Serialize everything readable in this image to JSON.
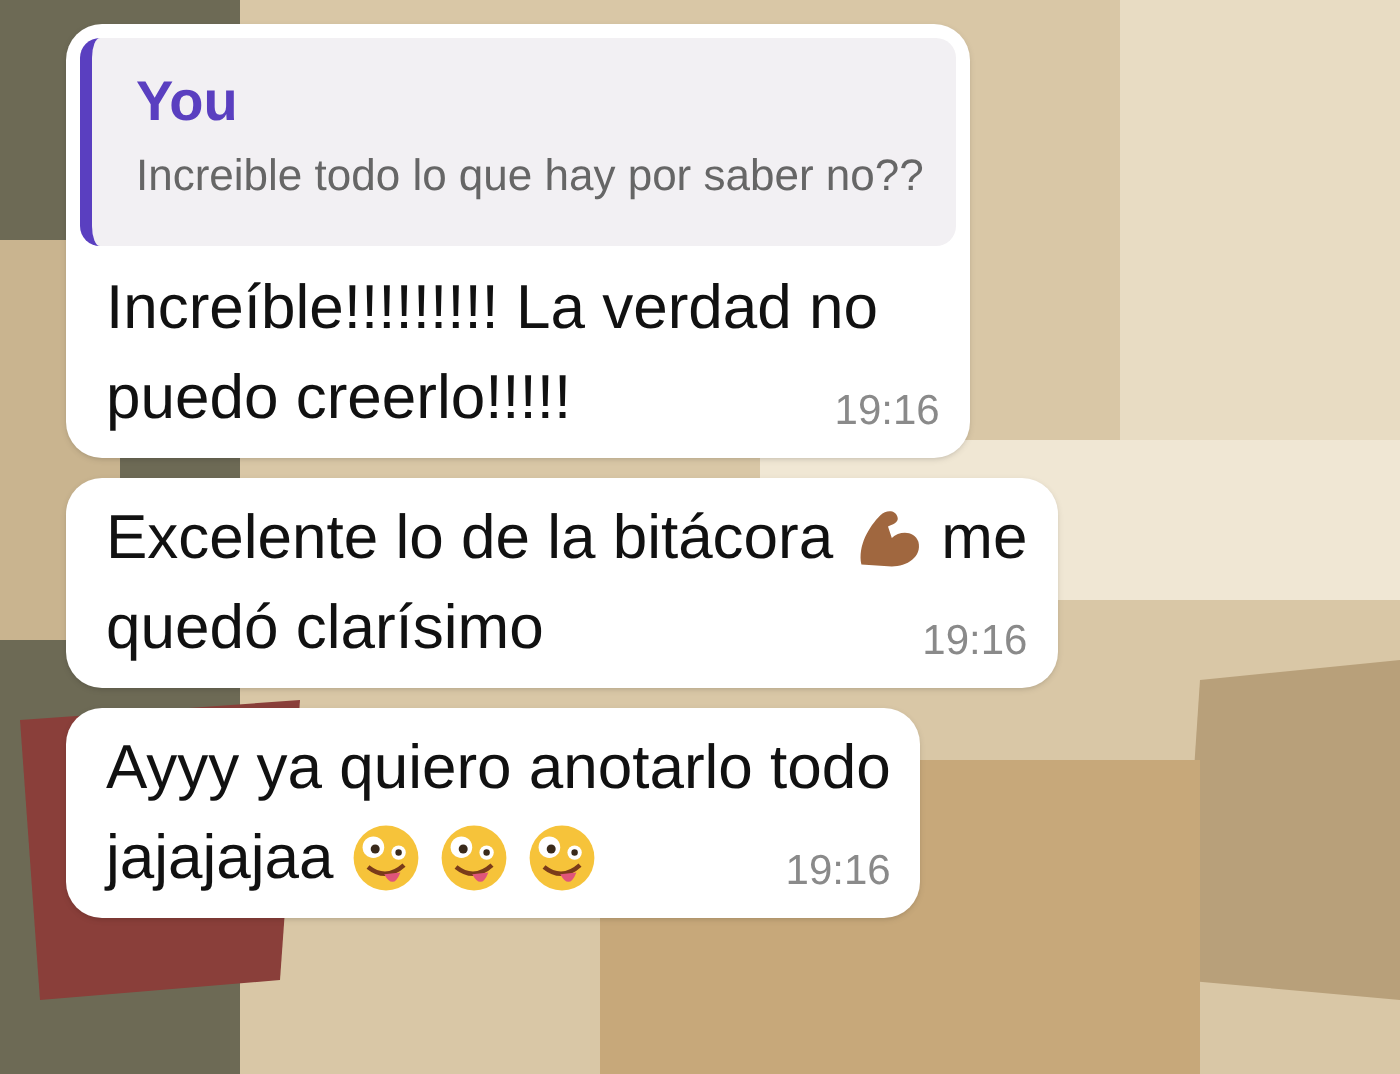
{
  "messages": [
    {
      "reply": {
        "author": "You",
        "text": "Increible todo lo que hay por saber no??"
      },
      "lines": [
        [
          {
            "kind": "text",
            "text": "Increíble!!!!!!!!! La verdad no"
          }
        ],
        [
          {
            "kind": "text",
            "text": "puedo creerlo!!!!!"
          }
        ]
      ],
      "time": "19:16"
    },
    {
      "lines": [
        [
          {
            "kind": "text",
            "text": "Excelente lo de la bitácora"
          },
          {
            "kind": "flexed-arm"
          },
          {
            "kind": "text",
            "text": "me"
          }
        ],
        [
          {
            "kind": "text",
            "text": "quedó clarísimo"
          }
        ]
      ],
      "time": "19:16"
    },
    {
      "lines": [
        [
          {
            "kind": "text",
            "text": "Ayyy ya quiero anotarlo todo"
          }
        ],
        [
          {
            "kind": "text",
            "text": "jajajajaa"
          },
          {
            "kind": "zany-face"
          },
          {
            "kind": "zany-face"
          },
          {
            "kind": "zany-face"
          }
        ]
      ],
      "time": "19:16"
    }
  ]
}
